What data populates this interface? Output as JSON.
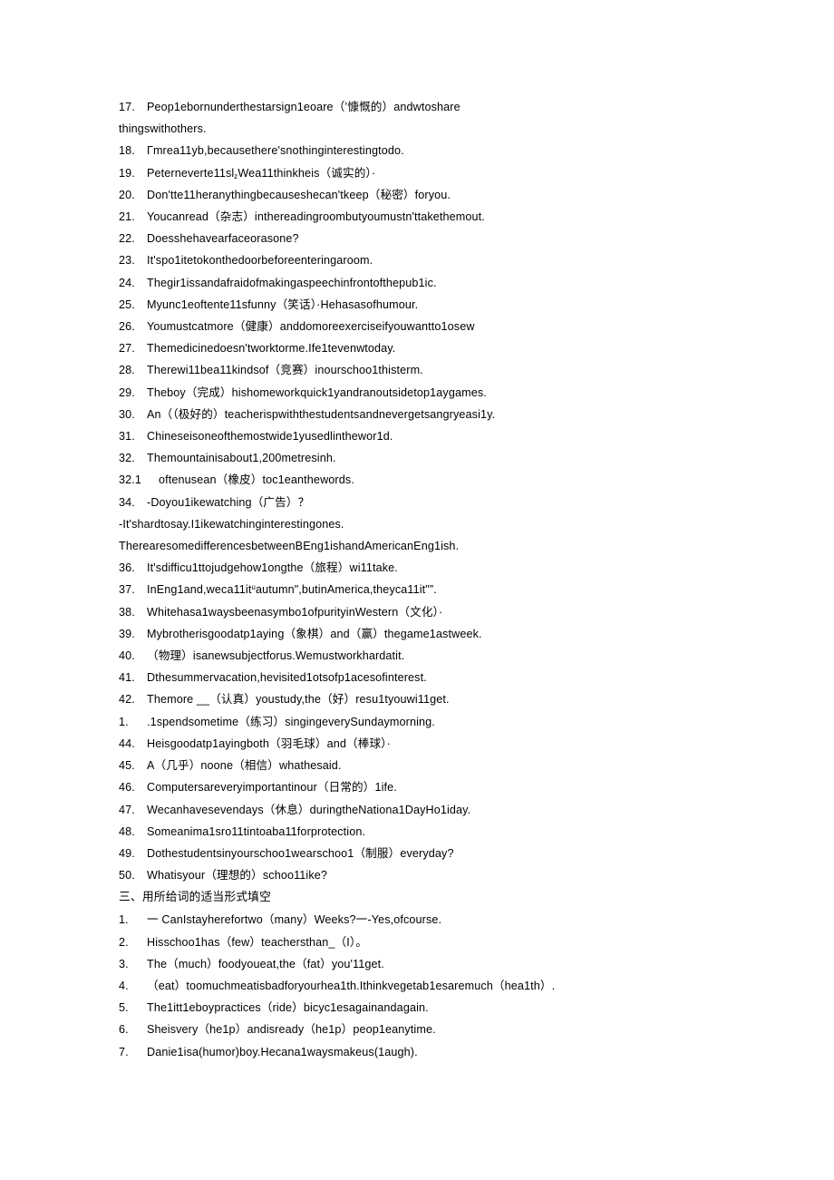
{
  "page": {
    "background_color": "#ffffff",
    "text_color": "#000000"
  },
  "content": {
    "lines": [
      {
        "id": "q17",
        "type": "numbered",
        "number": "17.",
        "text": "Peop1ebornunderthestarsign1eoare（’慷慨的）andwtoshare"
      },
      {
        "id": "q17b",
        "type": "flush",
        "number": "",
        "text": "thingswithothers."
      },
      {
        "id": "q18",
        "type": "numbered",
        "number": "18.",
        "text": "Гmrea11yb,becausethere'snothinginterestingtodo."
      },
      {
        "id": "q19",
        "type": "numbered",
        "number": "19.",
        "text": "Peterneverte11sl₂Wea11thinkheis（诚实的）·"
      },
      {
        "id": "q20",
        "type": "numbered",
        "number": "20.",
        "text": "Don'tte11heranythingbecauseshecan'tkeep（秘密）foryou."
      },
      {
        "id": "q21",
        "type": "numbered",
        "number": "21.",
        "text": "Youcanread（杂志）inthereadingroombutyoumustn'ttakethemout."
      },
      {
        "id": "q22",
        "type": "numbered",
        "number": "22.",
        "text": "Doesshehavearfaceorasone?"
      },
      {
        "id": "q23",
        "type": "numbered",
        "number": "23.",
        "text": "It'spo1itetokonthedoorbeforeenteringaroom."
      },
      {
        "id": "q24",
        "type": "numbered",
        "number": "24.",
        "text": "Thegir1issandafraidofmakingaspeechinfrontofthepub1ic."
      },
      {
        "id": "q25",
        "type": "numbered",
        "number": "25.",
        "text": "Myunc1eoftente11sfunny（笑话）·Hehasasofhumour."
      },
      {
        "id": "q26",
        "type": "numbered",
        "number": "26.",
        "text": "Youmustcatmore（健康）anddomoreexerciseifyouwantto1osew"
      },
      {
        "id": "q27",
        "type": "numbered",
        "number": "27.",
        "text": "Themedicinedoesn'tworktorme.Ife1tevenwtoday."
      },
      {
        "id": "q28",
        "type": "numbered",
        "number": "28.",
        "text": "Therewi11bea11kindsof（竞赛）inourschoo1thisterm."
      },
      {
        "id": "q29",
        "type": "numbered",
        "number": "29.",
        "text": "Theboy（完成）hishomeworkquick1yandranoutsidetop1aygames."
      },
      {
        "id": "q30",
        "type": "numbered",
        "number": "30.",
        "text": "An（（极好的）teacherispwiththestudentsandnevergetsangryeasi1y."
      },
      {
        "id": "q31",
        "type": "numbered",
        "number": "31.",
        "text": "Chineseisoneofthemostwide1yusedlinthewor1d."
      },
      {
        "id": "q32",
        "type": "numbered",
        "number": "32.",
        "text": "Themountainisabout1,200metresinh."
      },
      {
        "id": "q32_1",
        "type": "numbered-wide",
        "number": "32.1",
        "text": "oftenusean（橡皮）toc1eanthewords."
      },
      {
        "id": "q34",
        "type": "numbered",
        "number": "34.",
        "text": "-Doyou1ikewatching（广告）？"
      },
      {
        "id": "q34b",
        "type": "flush",
        "number": "",
        "text": "-It'shardtosay.I1ikewatchinginterestingones."
      },
      {
        "id": "q35",
        "type": "flush",
        "number": "",
        "text": "TherearesomedifferencesbetweenBEng1ishandAmericanEng1ish."
      },
      {
        "id": "q36",
        "type": "numbered",
        "number": "36.",
        "text": "It'sdifficu1ttojudgehow1ongthe（旅程）wi11take."
      },
      {
        "id": "q37",
        "type": "numbered",
        "number": "37.",
        "text": "InEng1and,weca11itᵘautumn\",butinAmerica,theyca11it\"”."
      },
      {
        "id": "q38",
        "type": "numbered",
        "number": "38.",
        "text": "Whitehasa1waysbeenasymbo1ofpurityinWestern（文化）·"
      },
      {
        "id": "q39",
        "type": "numbered",
        "number": "39.",
        "text": "Mybrotherisgoodatp1aying（象棋）and（赢）thegame1astweek."
      },
      {
        "id": "q40",
        "type": "numbered",
        "number": "40.",
        "text": "（物理）isanewsubjectforus.Wemustworkhardatit."
      },
      {
        "id": "q41",
        "type": "numbered",
        "number": "41.",
        "text": "Dthesummervacation,hevisited1otsofp1acesofinterest."
      },
      {
        "id": "q42",
        "type": "numbered",
        "number": "42.",
        "text": "Themore __（认真）youstudy,the（好）resu1tyouwi11get."
      },
      {
        "id": "q43",
        "type": "numbered",
        "number": "1.",
        "text": ".1spendsometime（练习）singingeverySundaymorning."
      },
      {
        "id": "q44",
        "type": "numbered",
        "number": "44.",
        "text": "Heisgoodatp1ayingboth（羽毛球）and（棒球）·"
      },
      {
        "id": "q45",
        "type": "numbered",
        "number": "45.",
        "text": "A（几乎）noone（相信）whathesaid."
      },
      {
        "id": "q46",
        "type": "numbered",
        "number": "46.",
        "text": "Computersareveryimportantinour（日常的）1ife."
      },
      {
        "id": "q47",
        "type": "numbered",
        "number": "47.",
        "text": "Wecanhavesevendays（休息）duringtheNationa1DayHo1iday."
      },
      {
        "id": "q48",
        "type": "numbered",
        "number": "48.",
        "text": "Someanima1sro11tintoaba11forprotection."
      },
      {
        "id": "q49",
        "type": "numbered",
        "number": "49.",
        "text": "Dothestudentsinyourschoo1wearschoo1（制服）everyday?"
      },
      {
        "id": "q50",
        "type": "numbered",
        "number": "50.",
        "text": "Whatisyour（理想的）schoo11ike?"
      },
      {
        "id": "sec3",
        "type": "heading",
        "number": "",
        "text": "三、用所给词的适当形式填空"
      },
      {
        "id": "s3q1",
        "type": "numbered",
        "number": "1.",
        "text": "一 CanIstayherefortwo（many）Weeks?一-Yes,ofcourse."
      },
      {
        "id": "s3q2",
        "type": "numbered",
        "number": "2.",
        "text": "Hisschoo1has（few）teachersthan_（I）。"
      },
      {
        "id": "s3q3",
        "type": "numbered",
        "number": "3.",
        "text": "The（much）foodyoueat,the（fat）you'11get."
      },
      {
        "id": "s3q4",
        "type": "numbered",
        "number": "4.",
        "text": "（eat）toomuchmeatisbadforyourhea1th.Ithinkvegetab1esaremuch（hea1th）."
      },
      {
        "id": "s3q5",
        "type": "numbered",
        "number": "5.",
        "text": "The1itt1eboypractices（ride）bicyc1esagainandagain."
      },
      {
        "id": "s3q6",
        "type": "numbered",
        "number": "6.",
        "text": "Sheisvery（he1p）andisready（he1p）peop1eanytime."
      },
      {
        "id": "s3q7",
        "type": "numbered",
        "number": "7.",
        "text": "Danie1isa(humor)boy.Hecana1waysmakeus(1augh)."
      }
    ]
  }
}
